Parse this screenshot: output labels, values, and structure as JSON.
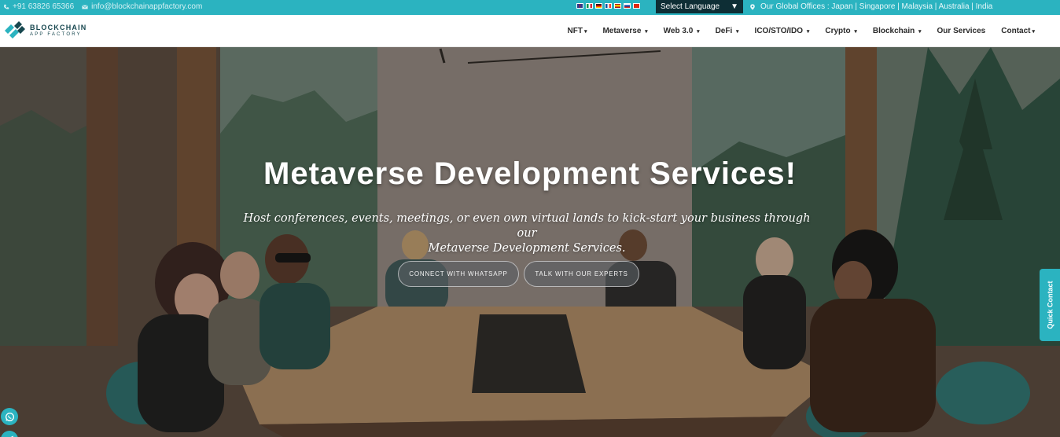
{
  "topbar": {
    "phone": "+91 63826 65366",
    "email": "info@blockchainappfactory.com",
    "language_select": "Select Language",
    "language_caret": "▼",
    "offices": "Our Global Offices : Japan | Singapore | Malaysia | Australia | India",
    "flags": [
      "english-flag",
      "italian-flag",
      "german-flag",
      "french-flag",
      "spanish-flag",
      "russian-flag",
      "chinese-flag"
    ]
  },
  "nav": {
    "logo_line1": "BLOCKCHAIN",
    "logo_line2": "APP FACTORY",
    "items": [
      {
        "label": "NFT",
        "caret": "▾"
      },
      {
        "label": "Metaverse",
        "caret": "▾"
      },
      {
        "label": "Web 3.0",
        "caret": "▾"
      },
      {
        "label": "DeFi",
        "caret": "▾"
      },
      {
        "label": "ICO/STO/IDO",
        "caret": "▾"
      },
      {
        "label": "Crypto",
        "caret": "▾"
      },
      {
        "label": "Blockchain",
        "caret": "▾"
      },
      {
        "label": "Our Services",
        "caret": ""
      },
      {
        "label": "Contact",
        "caret": "▾"
      }
    ]
  },
  "hero": {
    "title": "Metaverse Development Services!",
    "subtitle_line1": "Host conferences, events, meetings, or even own virtual lands to kick-start your business through our",
    "subtitle_line2": "Metaverse Development Services.",
    "button_whatsapp": "CONNECT WITH WHATSAPP",
    "button_experts": "TALK WITH OUR EXPERTS"
  },
  "sidebar": {
    "quick_contact": "Quick Contact"
  },
  "colors": {
    "accent": "#2bb3c0",
    "language_bg": "#0e2e35",
    "logo_text": "#17474f"
  }
}
